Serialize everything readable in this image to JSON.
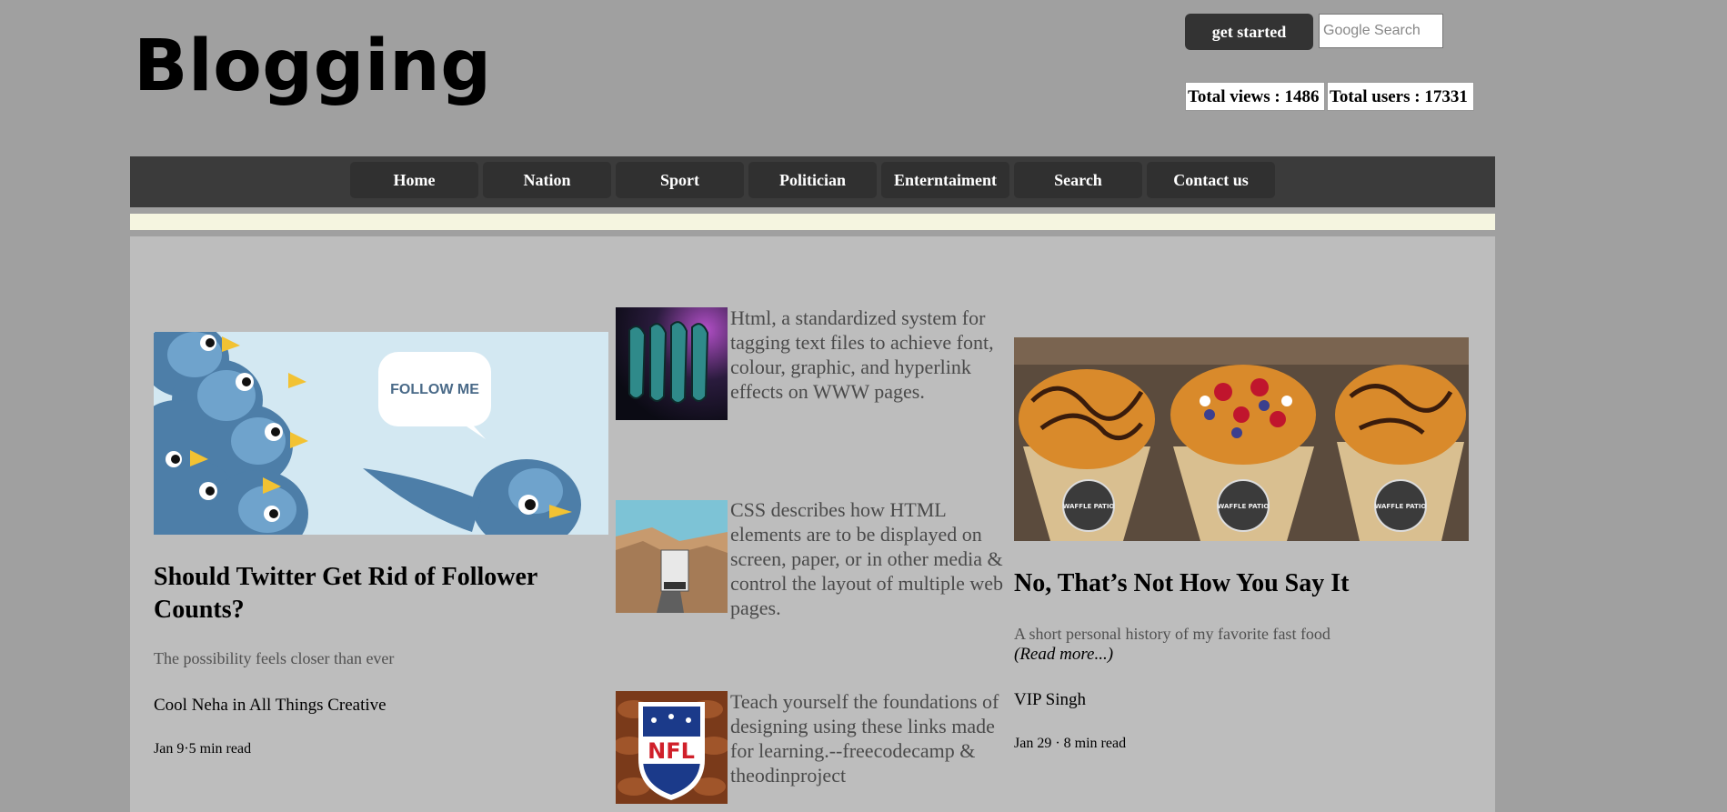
{
  "header": {
    "logo": "Blogging",
    "get_started_label": "get started",
    "search_placeholder": "Google Search",
    "total_views": "Total views : 1486",
    "total_users": "Total users : 17331"
  },
  "nav": {
    "items": [
      {
        "label": "Home"
      },
      {
        "label": "Nation"
      },
      {
        "label": "Sport"
      },
      {
        "label": "Politician"
      },
      {
        "label": "Enterntaiment"
      },
      {
        "label": "Search"
      },
      {
        "label": "Contact us"
      }
    ]
  },
  "left_card": {
    "image_text": "FOLLOW ME",
    "title": "Should Twitter Get Rid of Follower Counts?",
    "subtitle": "The possibility feels closer than ever",
    "author": "Cool Neha in All Things Creative",
    "meta": "Jan 9·5 min read"
  },
  "middle_list": [
    {
      "text": "Html, a standardized system for tagging text files to achieve font, colour, graphic, and hyperlink effects on WWW pages."
    },
    {
      "text": "CSS describes how HTML elements are to be displayed on screen, paper, or in other media & control the layout of multiple web pages."
    },
    {
      "text": "Teach yourself the foundations of designing using these links made for learning.--freecodecamp & theodinproject"
    }
  ],
  "right_card": {
    "image_label": "WAFFLE PATIO",
    "title": "No, That’s Not How You Say It",
    "subtitle": "A short personal history of my favorite fast food",
    "read_more": "(Read more...)",
    "author": "VIP Singh",
    "meta": "Jan 29 · 8 min read"
  },
  "colors": {
    "page_bg": "#a0a0a0",
    "nav_bg": "#3b3b3b",
    "content_bg": "#bdbdbd",
    "ticker_bg": "#f5f5e0"
  }
}
